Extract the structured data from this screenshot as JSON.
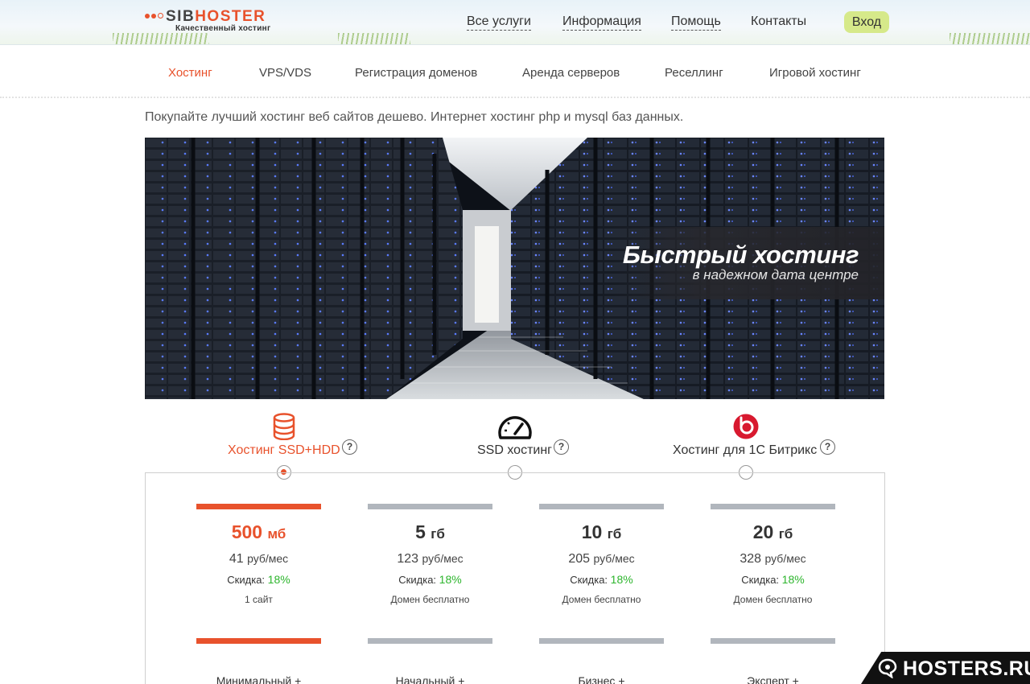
{
  "header": {
    "logo": {
      "part1": "SIB",
      "part2": "HOSTER",
      "tagline": "Качественный хостинг"
    },
    "nav": [
      {
        "label": "Все услуги"
      },
      {
        "label": "Информация"
      },
      {
        "label": "Помощь"
      },
      {
        "label": "Контакты"
      }
    ],
    "login_label": "Вход"
  },
  "subnav": {
    "items": [
      {
        "label": "Хостинг",
        "active": true
      },
      {
        "label": "VPS/VDS"
      },
      {
        "label": "Регистрация доменов"
      },
      {
        "label": "Аренда серверов"
      },
      {
        "label": "Реселлинг"
      },
      {
        "label": "Игровой хостинг"
      }
    ]
  },
  "intro": "Покупайте лучший хостинг веб сайтов дешево. Интернет хостинг php и mysql баз данных.",
  "banner": {
    "title": "Быстрый хостинг",
    "subtitle": "в надежном дата центре"
  },
  "hosting_types": [
    {
      "label": "Хостинг SSD+HDD",
      "icon": "database-icon",
      "selected": true,
      "help": "?"
    },
    {
      "label": "SSD хостинг",
      "icon": "speedometer-icon",
      "selected": false,
      "help": "?"
    },
    {
      "label": "Хостинг для 1С Битрикс",
      "icon": "bitrix-icon",
      "selected": false,
      "help": "?"
    }
  ],
  "plans": [
    {
      "size": "500",
      "unit": "мб",
      "price": "41",
      "price_unit": "руб/мес",
      "discount_label": "Скидка:",
      "discount": "18%",
      "note": "1 сайт",
      "name": "Минимальный +",
      "active": true
    },
    {
      "size": "5",
      "unit": "гб",
      "price": "123",
      "price_unit": "руб/мес",
      "discount_label": "Скидка:",
      "discount": "18%",
      "note": "Домен бесплатно",
      "name": "Начальный +"
    },
    {
      "size": "10",
      "unit": "гб",
      "price": "205",
      "price_unit": "руб/мес",
      "discount_label": "Скидка:",
      "discount": "18%",
      "note": "Домен бесплатно",
      "name": "Бизнес +"
    },
    {
      "size": "20",
      "unit": "гб",
      "price": "328",
      "price_unit": "руб/мес",
      "discount_label": "Скидка:",
      "discount": "18%",
      "note": "Домен бесплатно",
      "name": "Эксперт +"
    }
  ],
  "watermark": "HOSTERS.RU",
  "colors": {
    "accent": "#e8522c",
    "discount": "#2db52d",
    "login_bg": "#d6e98a",
    "bar_inactive": "#b1b6bd"
  }
}
